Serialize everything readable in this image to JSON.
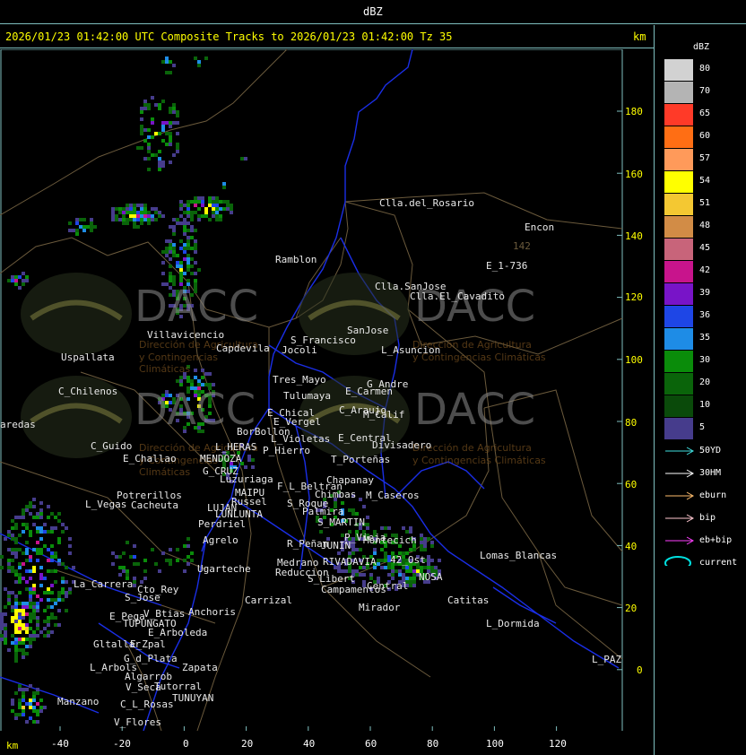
{
  "window": {
    "title": "dBZ"
  },
  "header": {
    "caption": "2026/01/23 01:42:00 UTC Composite Tracks to 2026/01/23 01:42:00 Tz 35",
    "unit": "km"
  },
  "axes": {
    "y_ticks": [
      "180",
      "160",
      "140",
      "120",
      "100",
      "80",
      "60",
      "40",
      "20",
      "0"
    ],
    "x_ticks": [
      "-40",
      "-20",
      "0",
      "20",
      "40",
      "60",
      "80",
      "100",
      "120"
    ],
    "x_unit": "km"
  },
  "legend": {
    "title": "dBZ",
    "scale": [
      {
        "label": "80",
        "color": "#d2d2d2"
      },
      {
        "label": "70",
        "color": "#b4b4b4"
      },
      {
        "label": "65",
        "color": "#ff3a28"
      },
      {
        "label": "60",
        "color": "#ff6e14"
      },
      {
        "label": "57",
        "color": "#ff9a5a"
      },
      {
        "label": "54",
        "color": "#ffff00"
      },
      {
        "label": "51",
        "color": "#f4c832"
      },
      {
        "label": "48",
        "color": "#d28c46"
      },
      {
        "label": "45",
        "color": "#c8647a"
      },
      {
        "label": "42",
        "color": "#c8148c"
      },
      {
        "label": "39",
        "color": "#7814c8"
      },
      {
        "label": "36",
        "color": "#1e46e6"
      },
      {
        "label": "35",
        "color": "#1e8ce6"
      },
      {
        "label": "30",
        "color": "#0a8c0a"
      },
      {
        "label": "20",
        "color": "#0a640a"
      },
      {
        "label": "10",
        "color": "#0a4a0a"
      },
      {
        "label": "5",
        "color": "#463c8c"
      }
    ],
    "tracks": [
      {
        "label": "50YD",
        "color": "#40e0e0"
      },
      {
        "label": "30HM",
        "color": "#ffffff"
      },
      {
        "label": "eburn",
        "color": "#ffbe6e"
      },
      {
        "label": "bip",
        "color": "#ffc8d0"
      },
      {
        "label": "eb+bip",
        "color": "#ff40ff"
      },
      {
        "label": "current",
        "color": "#00e0e0"
      }
    ]
  },
  "watermark": {
    "name": "DACC",
    "line1": "Dirección de Agricultura",
    "line2": "y Contingencias Climáticas"
  },
  "places": [
    {
      "name": "Clla.del_Rosario"
    },
    {
      "name": "Encon"
    },
    {
      "name": "142"
    },
    {
      "name": "E_1-736"
    },
    {
      "name": "Ramblon"
    },
    {
      "name": "Clla.SanJose"
    },
    {
      "name": "Clla.El_Cavadito"
    },
    {
      "name": "Villavicencio"
    },
    {
      "name": "Capdevila"
    },
    {
      "name": "S_Francisco"
    },
    {
      "name": "Jocoli"
    },
    {
      "name": "SanJose"
    },
    {
      "name": "L_Asuncion"
    },
    {
      "name": "Uspallata"
    },
    {
      "name": "Tres_Mayo"
    },
    {
      "name": "Tulumaya"
    },
    {
      "name": "G_Andre"
    },
    {
      "name": "E_Carmen"
    },
    {
      "name": "C_Chilenos"
    },
    {
      "name": "E_Chical"
    },
    {
      "name": "C_Araujo"
    },
    {
      "name": "M_Calif"
    },
    {
      "name": "E_Vergel"
    },
    {
      "name": "aredas"
    },
    {
      "name": "BorBollon"
    },
    {
      "name": "L_Violetas"
    },
    {
      "name": "E_Central"
    },
    {
      "name": "P_Hierro"
    },
    {
      "name": "Divisadero"
    },
    {
      "name": "C_Guido"
    },
    {
      "name": "L_HERAS"
    },
    {
      "name": "E_Challao"
    },
    {
      "name": "MENDOZA"
    },
    {
      "name": "T_Porteñas"
    },
    {
      "name": "G_CRUZ"
    },
    {
      "name": "Luzuriaga"
    },
    {
      "name": "Chapanay"
    },
    {
      "name": "F_L_Beltran"
    },
    {
      "name": "MAIPU"
    },
    {
      "name": "Chimbas"
    },
    {
      "name": "M_Caseros"
    },
    {
      "name": "Potrerillos"
    },
    {
      "name": "Russel"
    },
    {
      "name": "S_Roque"
    },
    {
      "name": "L_Vegas"
    },
    {
      "name": "Cacheuta"
    },
    {
      "name": "LUJAN"
    },
    {
      "name": "LUNLUNTA"
    },
    {
      "name": "Palmira"
    },
    {
      "name": "Perdriel"
    },
    {
      "name": "S_MARTIN"
    },
    {
      "name": "Agrelo"
    },
    {
      "name": "R_Peñan"
    },
    {
      "name": "JUNIN"
    },
    {
      "name": "P_Vieja"
    },
    {
      "name": "Montecich"
    },
    {
      "name": "Lomas_Blancas"
    },
    {
      "name": "Ugarteche"
    },
    {
      "name": "Medrano"
    },
    {
      "name": "RIVADAVIA"
    },
    {
      "name": "Reduccion"
    },
    {
      "name": "S_Libert"
    },
    {
      "name": "Central"
    },
    {
      "name": "Campamentos"
    },
    {
      "name": "La_Carrera"
    },
    {
      "name": "Cto_Rey"
    },
    {
      "name": "Carrizal"
    },
    {
      "name": "S_Jose"
    },
    {
      "name": "Catitas"
    },
    {
      "name": "Mirador"
    },
    {
      "name": "Anchoris"
    },
    {
      "name": "E_Pega"
    },
    {
      "name": "V_Btias"
    },
    {
      "name": "L_Dormida"
    },
    {
      "name": "TUPUNGATO"
    },
    {
      "name": "E_Arboleda"
    },
    {
      "name": "Gltallar"
    },
    {
      "name": "E_Zpal"
    },
    {
      "name": "G_d_Plata"
    },
    {
      "name": "L_Arbols"
    },
    {
      "name": "Zapata"
    },
    {
      "name": "L_PAZ"
    },
    {
      "name": "Algarrob"
    },
    {
      "name": "V_Seca"
    },
    {
      "name": "Tutorral"
    },
    {
      "name": "TUNUYAN"
    },
    {
      "name": "Manzano"
    },
    {
      "name": "C_L_Rosas"
    },
    {
      "name": "V_Flores"
    },
    {
      "name": "42_Ost"
    },
    {
      "name": "NOSA"
    }
  ]
}
